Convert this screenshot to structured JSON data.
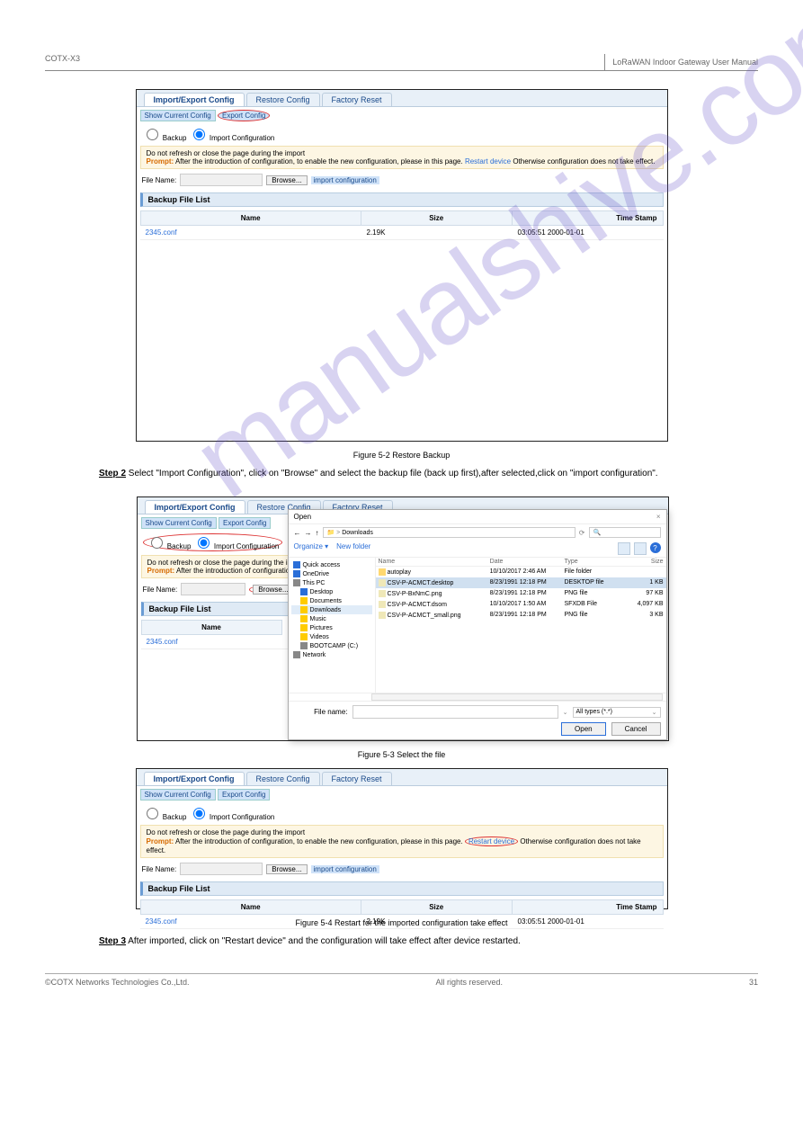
{
  "header": {
    "left": "COTX-X3",
    "right": "LoRaWAN Indoor Gateway User Manual"
  },
  "watermark": "manualshive.com",
  "tabs": {
    "t1": "Import/Export Config",
    "t2": "Restore Config",
    "t3": "Factory Reset"
  },
  "subbtn": {
    "show": "Show Current Config",
    "export": "Export Config"
  },
  "radio": {
    "backup": "Backup",
    "import": "Import Configuration"
  },
  "warn": {
    "line1": "Do not refresh or close the page during the import",
    "prompt": "Prompt:",
    "line2a": "After the introduction of configuration, to enable the new configuration, please in this page.",
    "link": "Restart device",
    "line2b": "Otherwise configuration does not take effect."
  },
  "warn2_trunc": "After the introduction of configuration, to e",
  "file": {
    "label": "File Name:",
    "browse": "Browse...",
    "import": "import configuration"
  },
  "section": {
    "backup": "Backup File List"
  },
  "tablehead": {
    "name": "Name",
    "size": "Size",
    "time": "Time Stamp"
  },
  "row": {
    "name": "2345.conf",
    "size": "2.19K",
    "time": "03:05:51 2000-01-01"
  },
  "fig1": "Figure 5-2 Restore Backup",
  "step2": {
    "label": "Step 2",
    "text": "Select \"Import Configuration\", click on \"Browse\" and select the backup file (back up first),after selected,click on \"import configuration\"."
  },
  "fig2": "Figure 5-3 Select the file",
  "step3": {
    "label": "Step 3",
    "text": "After imported, click on \"Restart device\" and the configuration will take effect after device restarted."
  },
  "fig3": "Figure 5-4 Restart for the imported configuration take effect",
  "dialog": {
    "title": "Open",
    "path": "Downloads",
    "nav": {
      "back": "←",
      "fwd": "→",
      "up": "↑",
      "sep": ">"
    },
    "search_ph": "",
    "search_icon": "🔍",
    "org": "Organize ▾",
    "newf": "New folder",
    "help": "?",
    "side": [
      {
        "label": "Quick access",
        "ico": "blue"
      },
      {
        "label": "OneDrive",
        "ico": "blue"
      },
      {
        "label": "This PC",
        "ico": "grey"
      },
      {
        "label": "Desktop",
        "ico": "blue",
        "indent": true
      },
      {
        "label": "Documents",
        "ico": "yellow",
        "indent": true
      },
      {
        "label": "Downloads",
        "ico": "yellow",
        "indent": true,
        "sel": true
      },
      {
        "label": "Music",
        "ico": "yellow",
        "indent": true
      },
      {
        "label": "Pictures",
        "ico": "yellow",
        "indent": true
      },
      {
        "label": "Videos",
        "ico": "yellow",
        "indent": true
      },
      {
        "label": "BOOTCAMP (C:)",
        "ico": "grey",
        "indent": true
      },
      {
        "label": "Network",
        "ico": "grey"
      }
    ],
    "cols": {
      "name": "Name",
      "date": "Date",
      "type": "Type",
      "size": "Size"
    },
    "files": [
      {
        "name": "autoplay",
        "date": "10/10/2017 2:46 AM",
        "type": "File folder",
        "size": "",
        "folder": true
      },
      {
        "name": "CSV-P-ACMCT.desktop",
        "date": "8/23/1991 12:18 PM",
        "type": "DESKTOP file",
        "size": "1 KB",
        "sel": true
      },
      {
        "name": "CSV-P-BxNmC.png",
        "date": "8/23/1991 12:18 PM",
        "type": "PNG file",
        "size": "97 KB"
      },
      {
        "name": "CSV-P-ACMCT.dsom",
        "date": "10/10/2017 1:50 AM",
        "type": "SFXDB File",
        "size": "4,097 KB"
      },
      {
        "name": "CSV-P-ACMCT_small.png",
        "date": "8/23/1991 12:18 PM",
        "type": "PNG file",
        "size": "3 KB"
      }
    ],
    "fnlabel": "File name:",
    "filter": "All types (*.*)",
    "open": "Open",
    "cancel": "Cancel",
    "dropchev": "⌄"
  },
  "footer": {
    "left": "©COTX Networks Technologies Co.,Ltd.",
    "mid": "All rights reserved.",
    "right": "31"
  }
}
